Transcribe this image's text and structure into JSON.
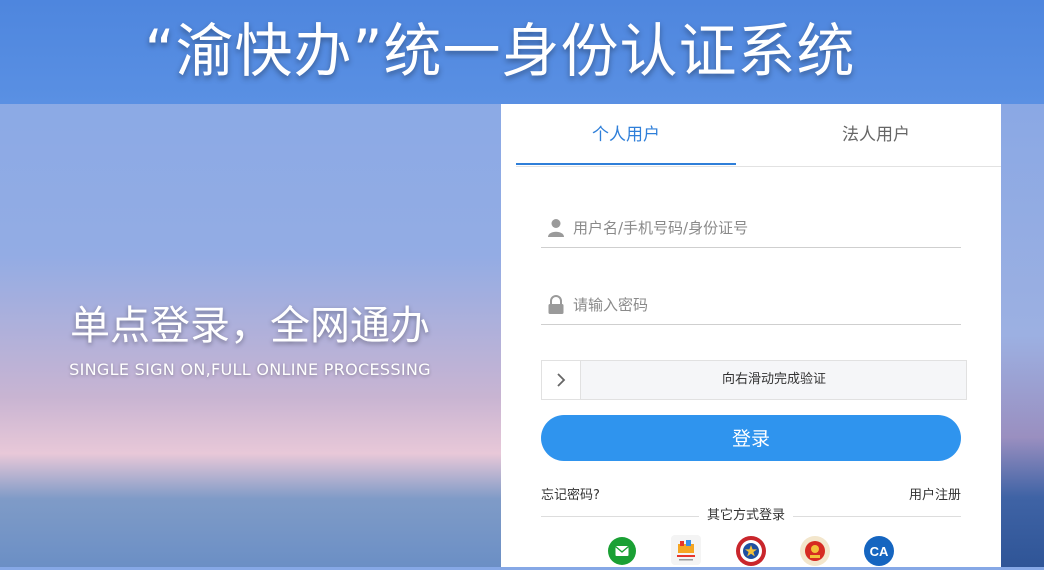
{
  "header": {
    "title": "“渝快办”统一身份认证系统"
  },
  "slogan": {
    "cn": "单点登录，全网通办",
    "en": "SINGLE SIGN ON,FULL ONLINE PROCESSING"
  },
  "tabs": [
    {
      "label": "个人用户",
      "active": true
    },
    {
      "label": "法人用户",
      "active": false
    }
  ],
  "form": {
    "username": {
      "value": "",
      "placeholder": "用户名/手机号码/身份证号",
      "icon": "user-icon"
    },
    "password": {
      "value": "",
      "placeholder": "请输入密码",
      "icon": "lock-icon"
    },
    "slider_text": "向右滑动完成验证",
    "login_label": "登录"
  },
  "links": {
    "forgot": "忘记密码?",
    "register": "用户注册"
  },
  "other_login": {
    "label": "其它方式登录",
    "methods": [
      {
        "icon": "message-icon",
        "color": "#1aa034"
      },
      {
        "icon": "gov-app-icon",
        "color": "#e7352b"
      },
      {
        "icon": "police-badge-icon",
        "color": "#c9262c"
      },
      {
        "icon": "national-emblem-icon",
        "color": "#d4a017"
      },
      {
        "icon": "ca-icon",
        "label": "CA",
        "color": "#1565c0"
      }
    ]
  },
  "colors": {
    "accent": "#2f7fd9",
    "button": "#2f94ee",
    "header": "#4e86de"
  }
}
